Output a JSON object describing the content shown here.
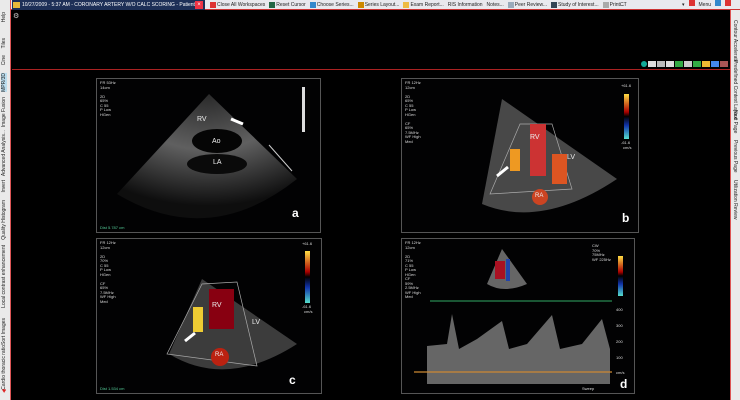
{
  "titlebar": {
    "title": "10/27/2009 - 5:37 AM - CORONARY ARTERY W/O CALC SCORING - Patient, 0"
  },
  "toolbar": {
    "items": [
      "Close All Workspaces",
      "Reset Cursor",
      "Choose Series...",
      "Series Layout...",
      "Exam Report...",
      "RIS Information",
      "Notes...",
      "Peer Review...",
      "Study of Interest...",
      "Print..."
    ],
    "modality": "CT",
    "menu": "Menu"
  },
  "left_tabs": [
    "Help",
    "Tiles",
    "Cine",
    "MPR/3D",
    "Image Fusion",
    "Advanced Analysis...",
    "Invert",
    "Quality Histogram",
    "Local contrast enhancement",
    "Sort Images",
    "Cardio thoracic ratio"
  ],
  "right_tabs": [
    "Contour Accelerate",
    "Predefined Context Layout",
    "Next Page",
    "Previous Page",
    "Utilization Review"
  ],
  "panels": {
    "a": {
      "info": "FR 53Hz\n14cm\n\n2D\n65%\nC 55\nP Low\nHGen",
      "labels": [
        "RV",
        "Ao",
        "LA"
      ],
      "letter": "a",
      "measure": "Dist 5.787 cm"
    },
    "b": {
      "info": "FR 12Hz\n12cm\n\n2D\n65%\nC 55\nP Low\nHGen\n\nCF\n65%\n7.5MHz\nWF High\nMed",
      "labels": [
        "RV",
        "LV",
        "RA"
      ],
      "letter": "b",
      "scale_top": "+61.6",
      "scale_bottom": "-61.6",
      "scale_unit": "cm/s"
    },
    "c": {
      "info": "FR 12Hz\n12cm\n\n2D\n70%\nC 55\nP Low\nHGen\n\nCF\n65%\n7.5MHz\nWF High\nMed",
      "labels": [
        "RV",
        "LV",
        "RA"
      ],
      "letter": "c",
      "measure": "Dist 1.534 cm",
      "scale_top": "+61.6",
      "scale_bottom": "-61.6",
      "scale_unit": "cm/s"
    },
    "d": {
      "info": "FR 12Hz\n12cm\n\n2D\n71%\nC 55\nP Low\nHGen\nCF\n59%\n2.5MHz\nWF High\nMed",
      "info_right": "CW\n70%\n75MHz\nWF 225Hz",
      "letter": "d",
      "axis": [
        "400",
        "300",
        "200",
        "100",
        "cm/s"
      ],
      "speed": "Sweep"
    }
  }
}
